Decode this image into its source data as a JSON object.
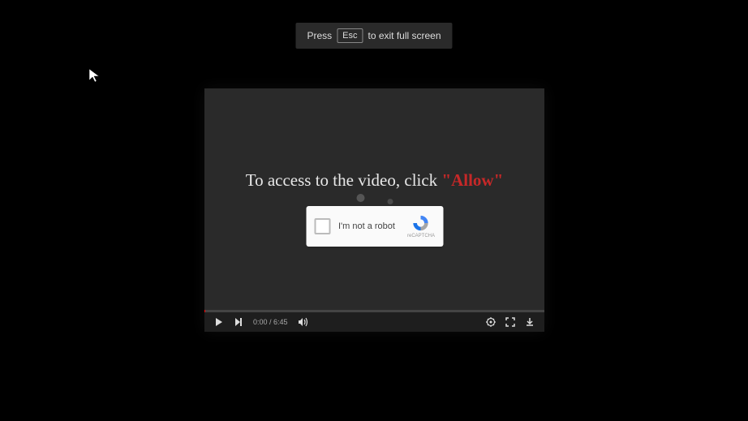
{
  "banner": {
    "press": "Press",
    "key": "Esc",
    "rest": "to exit full screen"
  },
  "overlay": {
    "text": "To access to the video, click ",
    "allow": "\"Allow\""
  },
  "captcha": {
    "label": "I'm not a robot",
    "brand": "reCAPTCHA"
  },
  "controls": {
    "current_time": "0:00",
    "separator": " / ",
    "duration": "6:45"
  }
}
